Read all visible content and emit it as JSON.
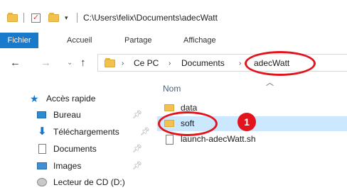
{
  "titlebar": {
    "dropdown_glyph": "▾",
    "path": "C:\\Users\\felix\\Documents\\adecWatt"
  },
  "ribbon": {
    "tabs": [
      "Fichier",
      "Accueil",
      "Partage",
      "Affichage"
    ]
  },
  "address": {
    "breadcrumbs": [
      "Ce PC",
      "Documents",
      "adecWatt"
    ]
  },
  "nav_pane": {
    "quick_access": "Accès rapide",
    "items": [
      "Bureau",
      "Téléchargements",
      "Documents",
      "Images",
      "Lecteur de CD (D:)"
    ]
  },
  "content": {
    "column_header": "Nom",
    "files": [
      {
        "name": "data",
        "type": "folder"
      },
      {
        "name": "soft",
        "type": "folder"
      },
      {
        "name": "launch-adecWatt.sh",
        "type": "file"
      }
    ]
  },
  "annotation": {
    "badge": "1",
    "color": "#e3141c"
  },
  "colors": {
    "accent": "#1979ca",
    "selection": "#cce8ff"
  }
}
